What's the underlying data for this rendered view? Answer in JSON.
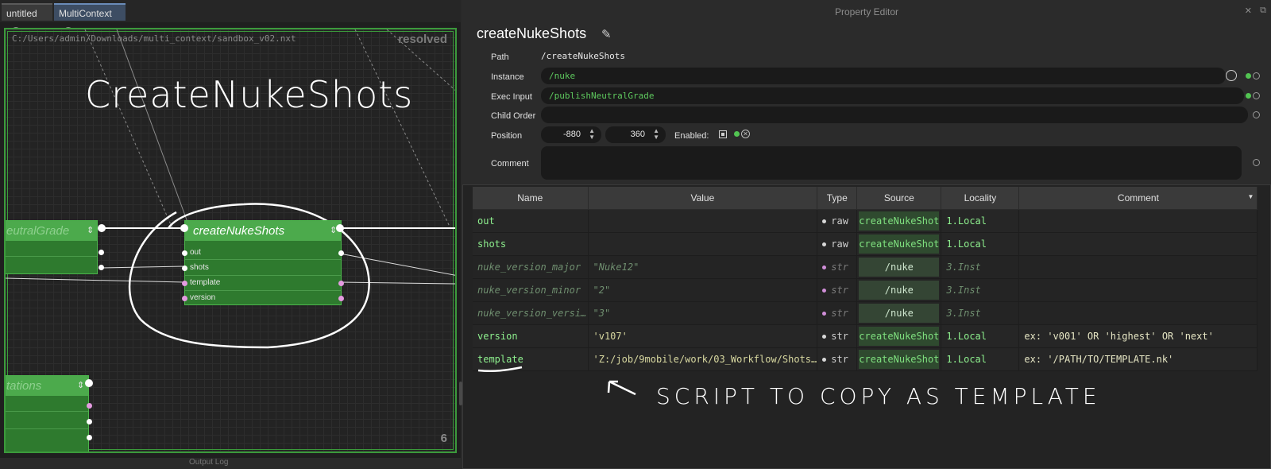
{
  "tabs": [
    {
      "label": "untitled"
    },
    {
      "label": "MultiContext"
    }
  ],
  "graph": {
    "file_path": "C:/Users/admin/Downloads/multi_context/sandbox_v02.nxt",
    "status": "resolved",
    "page_number": "6",
    "annotation_title": "CreateNukeShots",
    "nodes": {
      "neutral_grade": {
        "title": "eutralGrade"
      },
      "create_nuke_shots": {
        "title": "createNukeShots",
        "attrs": [
          "out",
          "shots",
          "template",
          "version"
        ]
      },
      "rotations": {
        "title": "tations"
      }
    }
  },
  "bottom_panel": {
    "label": "Output Log"
  },
  "property_editor": {
    "panel_title": "Property Editor",
    "node_name": "createNukeShots",
    "fields": {
      "path": {
        "label": "Path",
        "value": "/createNukeShots"
      },
      "instance": {
        "label": "Instance",
        "value": "/nuke"
      },
      "exec_input": {
        "label": "Exec Input",
        "value": "/publishNeutralGrade"
      },
      "child_order": {
        "label": "Child Order",
        "value": ""
      },
      "position": {
        "label": "Position",
        "x": "-880",
        "y": "360"
      },
      "enabled": {
        "label": "Enabled:"
      },
      "comment": {
        "label": "Comment",
        "value": ""
      }
    },
    "table": {
      "columns": [
        "Name",
        "Value",
        "Type",
        "Source",
        "Locality",
        "Comment"
      ],
      "rows": [
        {
          "name": "out",
          "value": "",
          "type": "raw",
          "source": "createNukeShot",
          "locality": "1.Local",
          "comment": "",
          "kind": "local"
        },
        {
          "name": "shots",
          "value": "",
          "type": "raw",
          "source": "createNukeShot",
          "locality": "1.Local",
          "comment": "",
          "kind": "local"
        },
        {
          "name": "nuke_version_major",
          "value": "\"Nuke12\"",
          "type": "str",
          "source": "/nuke",
          "locality": "3.Inst",
          "comment": "",
          "kind": "inst"
        },
        {
          "name": "nuke_version_minor",
          "value": "\"2\"",
          "type": "str",
          "source": "/nuke",
          "locality": "3.Inst",
          "comment": "",
          "kind": "inst"
        },
        {
          "name": "nuke_version_versi…",
          "value": "\"3\"",
          "type": "str",
          "source": "/nuke",
          "locality": "3.Inst",
          "comment": "",
          "kind": "inst"
        },
        {
          "name": "version",
          "value": "'v107'",
          "type": "str",
          "source": "createNukeShot",
          "locality": "1.Local",
          "comment": "ex: 'v001' OR 'highest' OR 'next'",
          "kind": "local"
        },
        {
          "name": "template",
          "value": "'Z:/job/9mobile/work/03_Workflow/Shots…",
          "type": "str",
          "source": "createNukeShot",
          "locality": "1.Local",
          "comment": "ex: '/PATH/TO/TEMPLATE.nk'",
          "kind": "local"
        }
      ]
    },
    "annotation": "SCRIPT TO COPY AS TEMPLATE"
  }
}
